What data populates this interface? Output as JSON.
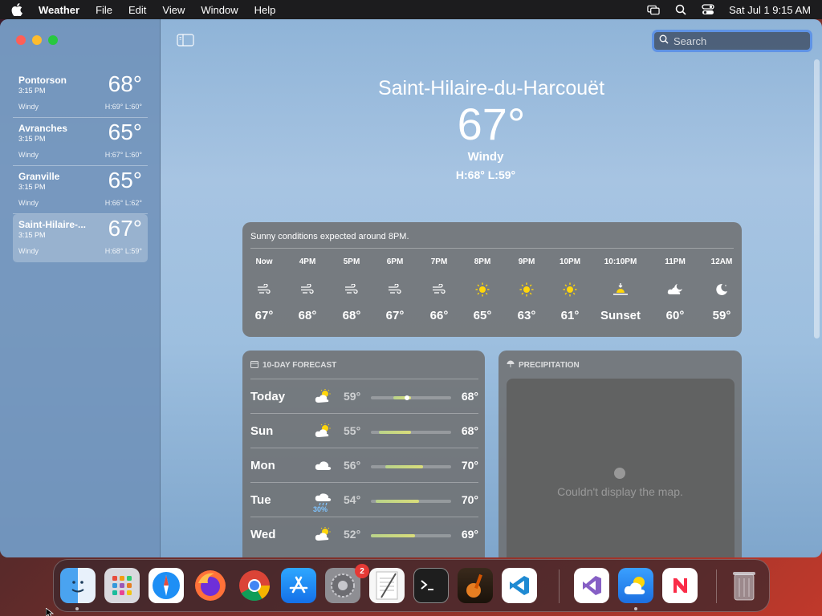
{
  "menubar": {
    "app_name": "Weather",
    "items": [
      "File",
      "Edit",
      "View",
      "Window",
      "Help"
    ],
    "datetime": "Sat Jul 1  9:15 AM"
  },
  "sidebar": {
    "cities": [
      {
        "name": "Pontorson",
        "time": "3:15 PM",
        "temp": "68°",
        "condition": "Windy",
        "hl": "H:69°  L:60°"
      },
      {
        "name": "Avranches",
        "time": "3:15 PM",
        "temp": "65°",
        "condition": "Windy",
        "hl": "H:67°  L:60°"
      },
      {
        "name": "Granville",
        "time": "3:15 PM",
        "temp": "65°",
        "condition": "Windy",
        "hl": "H:66°  L:62°"
      },
      {
        "name": "Saint-Hilaire-...",
        "time": "3:15 PM",
        "temp": "67°",
        "condition": "Windy",
        "hl": "H:68°  L:59°"
      }
    ]
  },
  "search": {
    "placeholder": "Search"
  },
  "current": {
    "location": "Saint-Hilaire-du-Harcouët",
    "temp": "67°",
    "condition": "Windy",
    "hl": "H:68°  L:59°"
  },
  "hourly": {
    "summary": "Sunny conditions expected around 8PM.",
    "hours": [
      {
        "label": "Now",
        "icon": "wind-icon",
        "temp": "67°"
      },
      {
        "label": "4PM",
        "icon": "wind-icon",
        "temp": "68°"
      },
      {
        "label": "5PM",
        "icon": "wind-icon",
        "temp": "68°"
      },
      {
        "label": "6PM",
        "icon": "wind-icon",
        "temp": "67°"
      },
      {
        "label": "7PM",
        "icon": "wind-icon",
        "temp": "66°"
      },
      {
        "label": "8PM",
        "icon": "sun-icon",
        "temp": "65°"
      },
      {
        "label": "9PM",
        "icon": "sun-icon",
        "temp": "63°"
      },
      {
        "label": "10PM",
        "icon": "sun-icon",
        "temp": "61°"
      },
      {
        "label": "10:10PM",
        "icon": "sunset-icon",
        "temp": "Sunset"
      },
      {
        "label": "11PM",
        "icon": "cloud-moon-icon",
        "temp": "60°"
      },
      {
        "label": "12AM",
        "icon": "moon-icon",
        "temp": "59°"
      }
    ]
  },
  "ten_day": {
    "title": "10-DAY FORECAST",
    "days": [
      {
        "day": "Today",
        "icon": "partly-sunny-icon",
        "low": "59°",
        "high": "68°",
        "precip": "",
        "range": [
          0.28,
          0.5
        ],
        "current": 0.45
      },
      {
        "day": "Sun",
        "icon": "partly-sunny-icon",
        "low": "55°",
        "high": "68°",
        "precip": "",
        "range": [
          0.1,
          0.5
        ]
      },
      {
        "day": "Mon",
        "icon": "cloud-icon",
        "low": "56°",
        "high": "70°",
        "precip": "",
        "range": [
          0.18,
          0.65
        ]
      },
      {
        "day": "Tue",
        "icon": "rain-icon",
        "low": "54°",
        "high": "70°",
        "precip": "30%",
        "range": [
          0.06,
          0.6
        ]
      },
      {
        "day": "Wed",
        "icon": "partly-sunny-icon",
        "low": "52°",
        "high": "69°",
        "precip": "",
        "range": [
          0.0,
          0.55
        ]
      }
    ]
  },
  "precipitation": {
    "title": "PRECIPITATION",
    "message": "Couldn't display the map."
  },
  "dock": {
    "badge": "2",
    "apps": [
      "finder",
      "launchpad",
      "safari",
      "firefox",
      "chrome",
      "app-store",
      "system-settings",
      "textedit",
      "terminal",
      "garageband",
      "vscode",
      "visual-studio",
      "weather",
      "news",
      "trash"
    ]
  }
}
